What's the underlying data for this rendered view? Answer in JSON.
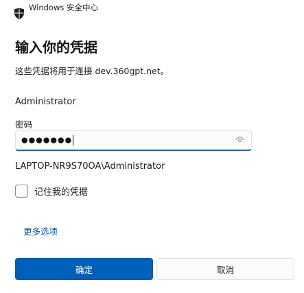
{
  "window": {
    "app_title": "Windows 安全中心"
  },
  "dialog": {
    "heading": "输入你的凭据",
    "subtitle": "这些凭据将用于连接 dev.360gpt.net。",
    "username": "Administrator",
    "password_label": "密码",
    "password_value": "●●●●●●●",
    "domain_user": "LAPTOP-NR9S70OA\\Administrator",
    "remember_label": "记住我的凭据",
    "remember_checked": false,
    "more_options": "更多选项"
  },
  "buttons": {
    "ok": "确定",
    "cancel": "取消"
  },
  "icons": {
    "app": "shield-icon",
    "reveal": "eye-icon"
  },
  "colors": {
    "accent": "#005fb8",
    "link": "#0053a6"
  }
}
